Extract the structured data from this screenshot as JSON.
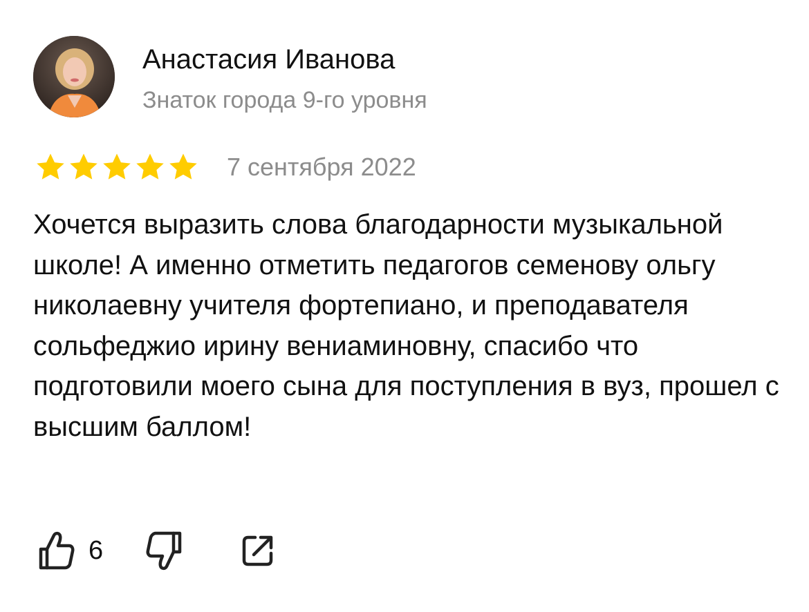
{
  "author": {
    "name": "Анастасия Иванова",
    "level": "Знаток города 9-го уровня",
    "avatar_icon": "user-photo"
  },
  "rating": {
    "stars": 5,
    "max": 5,
    "color": "#FFCC00",
    "date": "7 сентября 2022"
  },
  "review": {
    "text": "Хочется выразить слова благодарности музыкальной школе! А именно отметить педагогов семенову ольгу николаевну учителя фортепиано, и преподавателя сольфеджио ирину вениаминовну, спасибо что подготовили моего сына для поступления в вуз, прошел с высшим баллом!"
  },
  "actions": {
    "like_icon": "thumbs-up-icon",
    "like_count": "6",
    "dislike_icon": "thumbs-down-icon",
    "share_icon": "share-icon"
  }
}
